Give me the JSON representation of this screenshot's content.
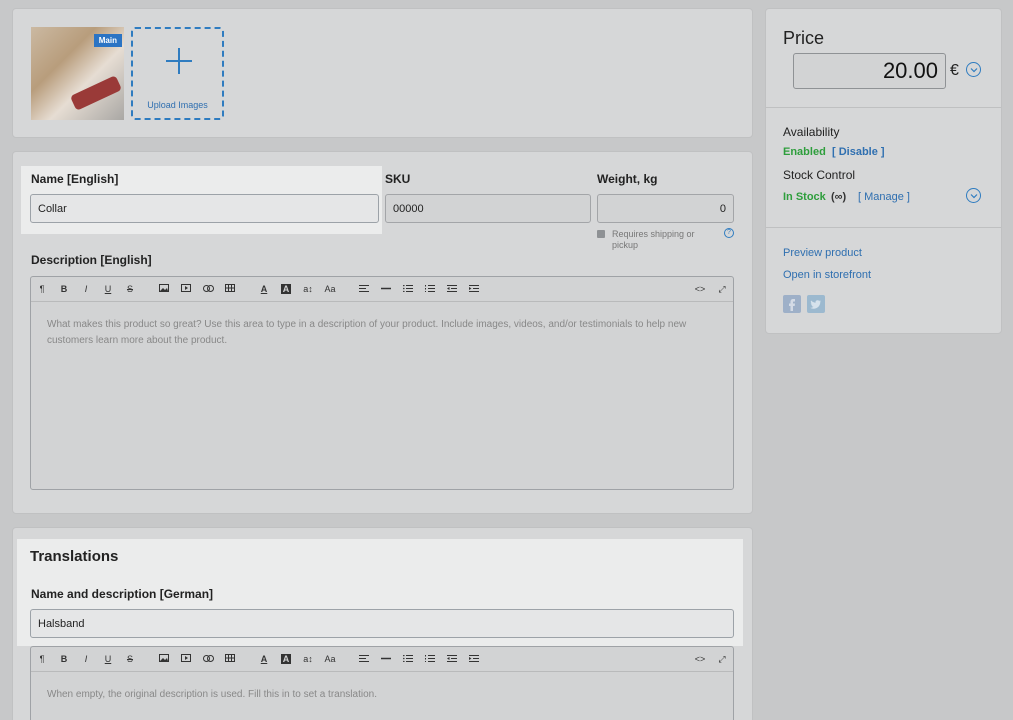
{
  "images": {
    "main_badge": "Main",
    "upload_label": "Upload Images"
  },
  "product": {
    "name_label": "Name [English]",
    "name_value": "Collar",
    "sku_label": "SKU",
    "sku_value": "00000",
    "weight_label": "Weight, kg",
    "weight_value": "0",
    "shipping_note": "Requires shipping or pickup",
    "help_icon": "?",
    "description_label": "Description [English]",
    "description_placeholder": "What makes this product so great? Use this area to type in a description of your product. Include images, videos, and/or testimonials to help new customers learn more about the product."
  },
  "toolbar": {
    "paragraph": "¶",
    "bold": "B",
    "italic": "I",
    "underline": "U",
    "strike": "S",
    "font_color": "A",
    "bg_color": "A",
    "font_size": "a↕",
    "font_case": "Aa",
    "code": "<>",
    "fullscreen": "⤢"
  },
  "translations": {
    "title": "Translations",
    "label": "Name and description [German]",
    "name_value": "Halsband",
    "description_placeholder": "When empty, the original description is used. Fill this in to set a translation."
  },
  "sidebar": {
    "price_label": "Price",
    "price_value": "20.00",
    "currency": "€",
    "availability_label": "Availability",
    "availability_status": "Enabled",
    "availability_action": "[ Disable ]",
    "stock_label": "Stock Control",
    "stock_status": "In Stock",
    "stock_qty": "(∞)",
    "stock_action": "[ Manage ]",
    "preview_link": "Preview product",
    "storefront_link": "Open in storefront"
  },
  "colors": {
    "accent": "#2f7cc0",
    "enabled_green": "#2e9e3c",
    "main_badge": "#2b74c4"
  }
}
